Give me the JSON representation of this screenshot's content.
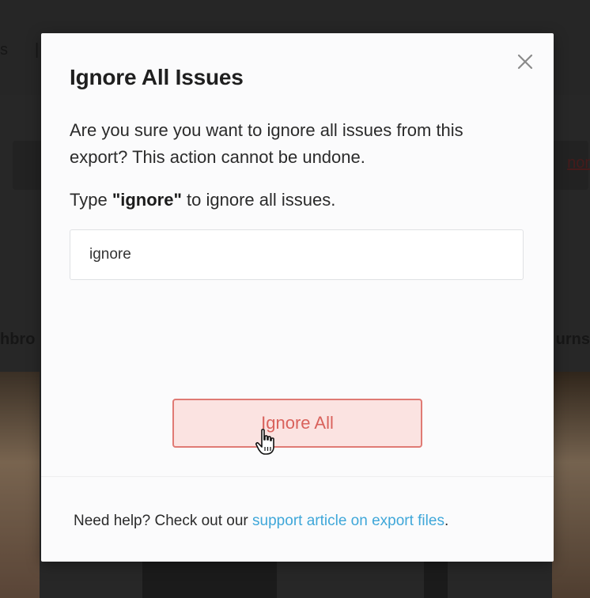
{
  "background": {
    "partial_left": "s",
    "partial_col_left": "hbro",
    "partial_col_right": "urns",
    "partial_link_right": "nor"
  },
  "modal": {
    "title": "Ignore All Issues",
    "close_icon": "close-icon",
    "message": "Are you sure you want to ignore all issues from this export? This action cannot be undone.",
    "type_prefix": "Type ",
    "type_keyword": "\"ignore\"",
    "type_suffix": " to ignore all issues.",
    "input_value": "ignore",
    "confirm_button_label": "Ignore All",
    "help_prefix": "Need help? Check out our ",
    "help_link": "support article on export files",
    "help_suffix": "."
  },
  "colors": {
    "danger_border": "#e07a74",
    "danger_bg": "#fbe3e1",
    "danger_text": "#d9625c",
    "link": "#3fa7d9"
  }
}
